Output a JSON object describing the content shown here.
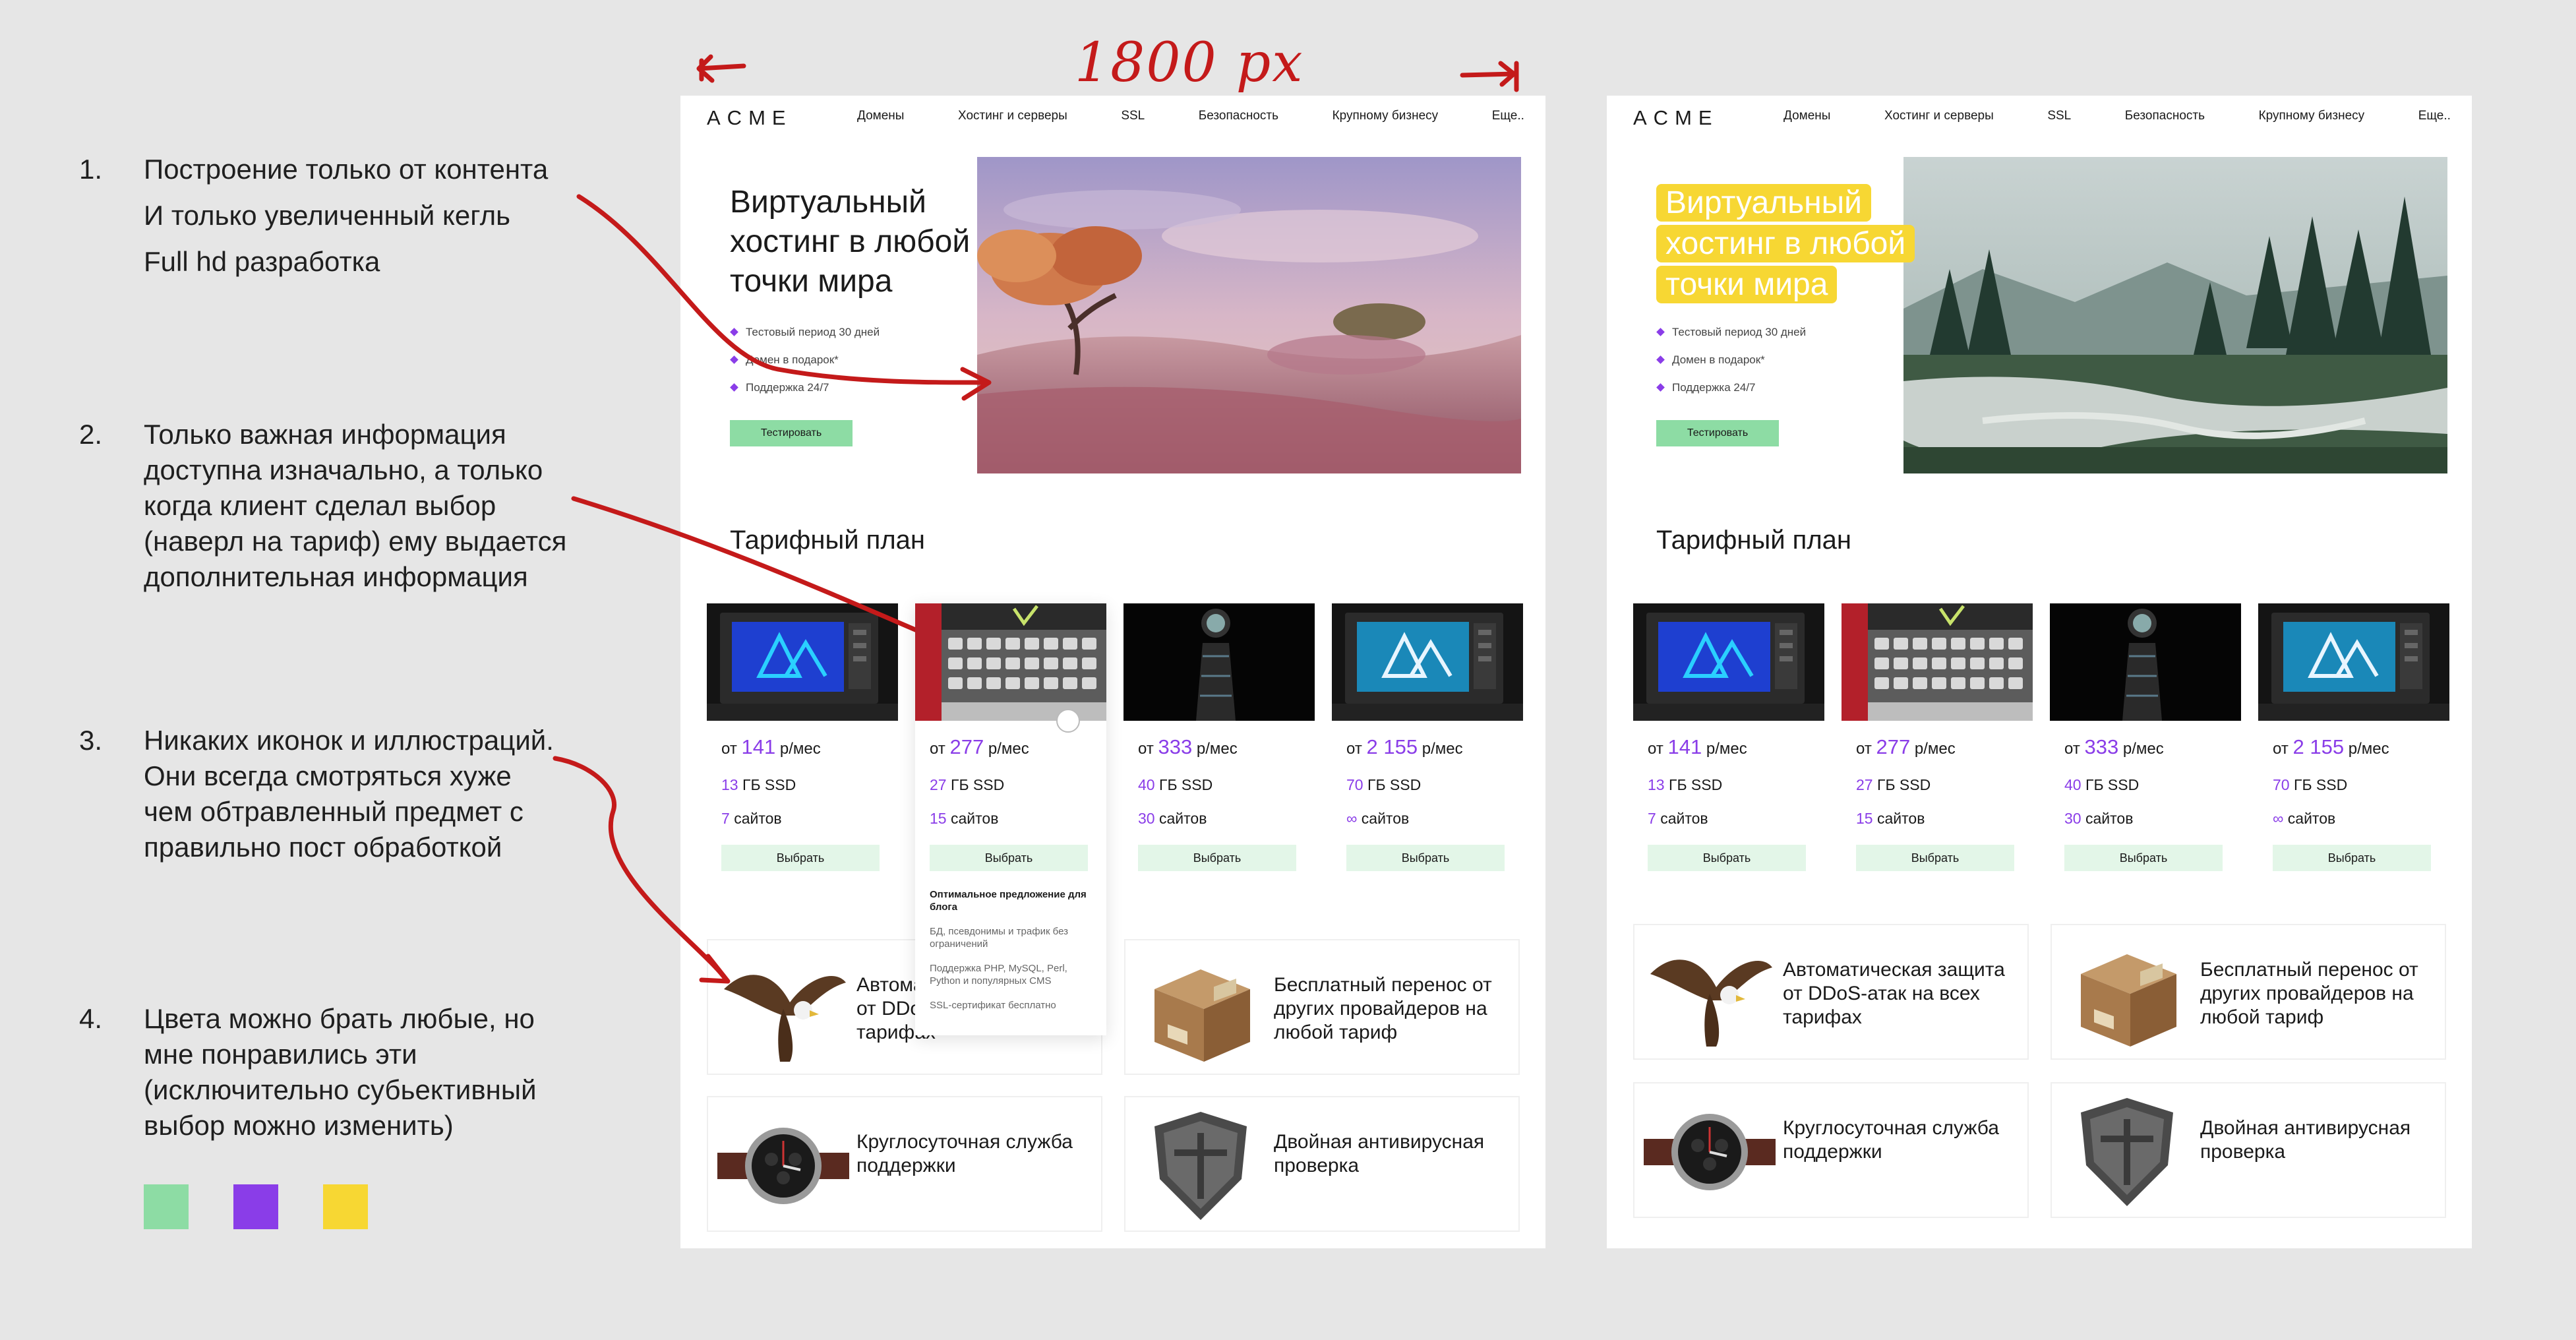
{
  "annotation": {
    "width_label": "1800 px"
  },
  "notes": [
    {
      "num": "1.",
      "lines": [
        "Построение только от контента",
        "И только увеличенный кегль",
        "Full hd разработка"
      ]
    },
    {
      "num": "2.",
      "lines": [
        "Только важная информация",
        "доступна изначально, а только",
        "когда клиент сделал выбор",
        "(наверл на тариф) ему выдается",
        "дополнительная информация"
      ]
    },
    {
      "num": "3.",
      "lines": [
        "Никаких иконок и иллюстраций.",
        "Они всегда смотряться хуже",
        "чем обтравленный предмет с",
        "правильно пост обработкой"
      ]
    },
    {
      "num": "4.",
      "lines": [
        "Цвета можно брать любые, но",
        "мне понравились эти",
        "(исключительно субьективный",
        "выбор можно изменить)"
      ]
    }
  ],
  "swatches": [
    "#8ddca4",
    "#8a3de8",
    "#f7d733"
  ],
  "site": {
    "logo": "ACME",
    "menu": [
      "Домены",
      "Хостинг и серверы",
      "SSL",
      "Безопасность",
      "Крупному бизнесу",
      "Еще.."
    ],
    "hero_title_lines": [
      "Виртуальный",
      "хостинг в любой",
      "точки мира"
    ],
    "bullets": [
      "Тестовый период 30 дней",
      "Домен в подарок*",
      "Поддержка 24/7"
    ],
    "test_button": "Тестировать",
    "plans_title": "Тарифный план",
    "plans": [
      {
        "prefix": "от",
        "price": "141",
        "unit": "р/мес",
        "ssd_value": "13",
        "ssd_label": "ГБ SSD",
        "sites_value": "7",
        "sites_label": "сайтов",
        "button": "Выбрать"
      },
      {
        "prefix": "от",
        "price": "277",
        "unit": "р/мес",
        "ssd_value": "27",
        "ssd_label": "ГБ SSD",
        "sites_value": "15",
        "sites_label": "сайтов",
        "button": "Выбрать"
      },
      {
        "prefix": "от",
        "price": "333",
        "unit": "р/мес",
        "ssd_value": "40",
        "ssd_label": "ГБ SSD",
        "sites_value": "30",
        "sites_label": "сайтов",
        "button": "Выбрать"
      },
      {
        "prefix": "от",
        "price": "2 155",
        "unit": "р/мес",
        "ssd_value": "70",
        "ssd_label": "ГБ SSD",
        "sites_value": "∞",
        "sites_label": "сайтов",
        "button": "Выбрать"
      }
    ],
    "plan_extra": {
      "heading": "Оптимальное предложение для блога",
      "items": [
        "БД, псевдонимы и трафик без ограничений",
        "Поддержка PHP, MySQL, Perl, Python и популярных CMS",
        "SSL-сертификат бесплатно"
      ]
    },
    "features": [
      {
        "text": "Автоматическая защита от DDoS-атак на всех тарифах",
        "truncated": "Автом от DDo тарифах"
      },
      {
        "text": "Бесплатный перенос от других провайдеров на любой тариф"
      },
      {
        "text": "Круглосуточная служба поддержки"
      },
      {
        "text": "Двойная антивирусная проверка"
      }
    ]
  }
}
